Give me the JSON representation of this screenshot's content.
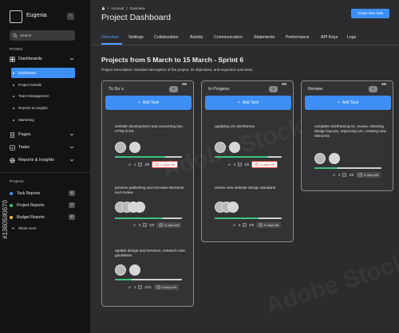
{
  "sidebar": {
    "brand": "Eugenia",
    "search_placeholder": "Search",
    "pages_label": "PAGES",
    "dashboards_label": "Dashboards",
    "sub_items": [
      "Dashboard",
      "Project Details",
      "Team Management",
      "Reports & Insights",
      "Marketing"
    ],
    "nav_items": [
      "Pages",
      "Tasks",
      "Reports & Insights"
    ],
    "projects_label": "Projects",
    "projects": [
      {
        "label": "Task Reports",
        "count": "6",
        "color": "#3d8ff5"
      },
      {
        "label": "Project Reports",
        "count": "2",
        "color": "#3bc47a"
      },
      {
        "label": "Budget Reports",
        "count": "37",
        "color": "#f2c230"
      }
    ],
    "show_more": "Show more"
  },
  "header": {
    "crumb_account": "Account",
    "crumb_overview": "Overview",
    "title": "Project Dashboard",
    "create_button": "Create New Task"
  },
  "tabs": [
    "Overview",
    "Settings",
    "Collaboration",
    "Activity",
    "Communication",
    "Statements",
    "Performance",
    "API Keys",
    "Logs"
  ],
  "sprint_title": "Projects from 5 March to 15 March - Sprint 6",
  "description": "Project Description: Detailed description of the project, its objectives, and expected outcomes.",
  "add_task_label": "Add Task",
  "columns": [
    {
      "title": "To Do`s",
      "count": "4",
      "cards": [
        {
          "text": "website development and converting into HTML/CSS",
          "progress": 0.75,
          "attachments": "2",
          "tasks": "4/8",
          "due": "3 days left",
          "due_style": "red"
        },
        {
          "text": "preview publishing and recreate elements and review",
          "progress": 0.72,
          "attachments": "6",
          "tasks": "6/8",
          "due": "5 days left",
          "due_style": "gray"
        },
        {
          "text": "update design and services, research new guidelines",
          "progress": 0.25,
          "attachments": "2",
          "tasks": "2/10",
          "due": "6 days left",
          "due_style": "gray"
        }
      ]
    },
    {
      "title": "In Progess",
      "count": "2",
      "cards": [
        {
          "text": "updating UX wireframes",
          "progress": 0.8,
          "attachments": "2",
          "tasks": "4/6",
          "due": "3 days left",
          "due_style": "red"
        },
        {
          "text": "review new website design standarts",
          "progress": 0.66,
          "attachments": "6",
          "tasks": "6/8",
          "due": "5 days left",
          "due_style": "gray"
        }
      ]
    },
    {
      "title": "Review",
      "count": "1",
      "cards": [
        {
          "text": "complete wireframing UI, review, retesting design layouts, improving UX, creating new elements",
          "progress": 0.35,
          "attachments": "4",
          "tasks": "4/9",
          "due": "5 days left",
          "due_style": "gray"
        }
      ]
    }
  ],
  "watermark": "Adobe Stock",
  "stock_id": "#1360590670",
  "colors": {
    "accent": "#3d8ff5",
    "progress": "#3bc47a",
    "due_urgent": "#e0453a"
  }
}
